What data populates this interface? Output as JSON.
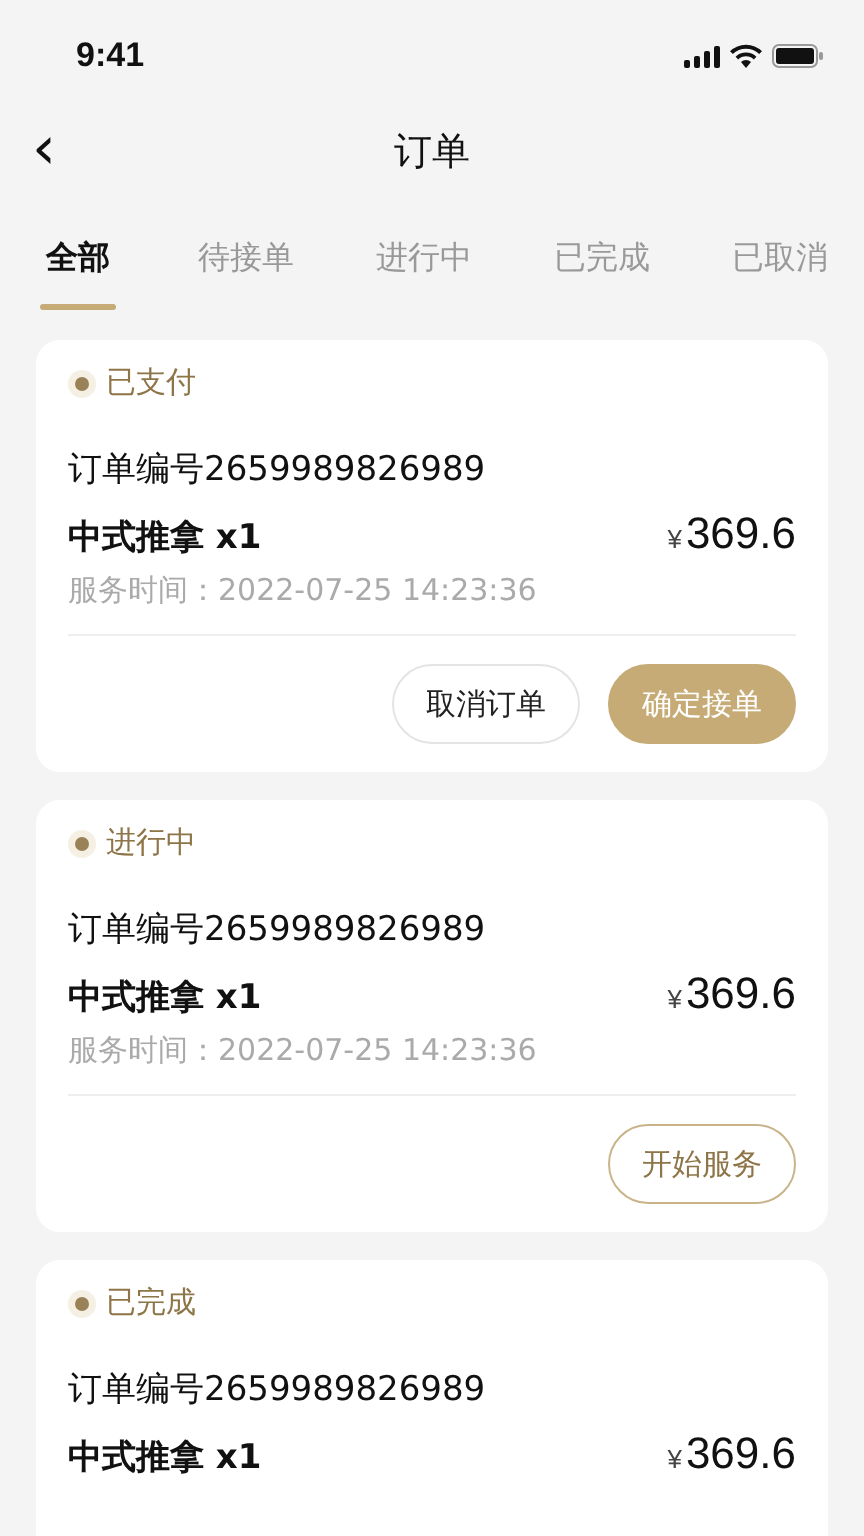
{
  "status_bar": {
    "time": "9:41"
  },
  "nav": {
    "title": "订单",
    "back": "‹"
  },
  "tabs": [
    {
      "label": "全部",
      "selected": true
    },
    {
      "label": "待接单",
      "selected": false
    },
    {
      "label": "进行中",
      "selected": false
    },
    {
      "label": "已完成",
      "selected": false
    },
    {
      "label": "已取消",
      "selected": false
    }
  ],
  "orders": [
    {
      "status": "已支付",
      "order_no": "订单编号2659989826989",
      "item": "中式推拿 x1",
      "currency": "¥",
      "price": "369.6",
      "service_time": "服务时间：2022-07-25 14:23:36",
      "buttons": [
        {
          "label": "取消订单",
          "kind": "outline"
        },
        {
          "label": "确定接单",
          "kind": "filled"
        }
      ]
    },
    {
      "status": "进行中",
      "order_no": "订单编号2659989826989",
      "item": "中式推拿 x1",
      "currency": "¥",
      "price": "369.6",
      "service_time": "服务时间：2022-07-25 14:23:36",
      "buttons": [
        {
          "label": "开始服务",
          "kind": "accent-outline"
        }
      ]
    },
    {
      "status": "已完成",
      "order_no": "订单编号2659989826989",
      "item": "中式推拿 x1",
      "currency": "¥",
      "price": "369.6"
    }
  ]
}
